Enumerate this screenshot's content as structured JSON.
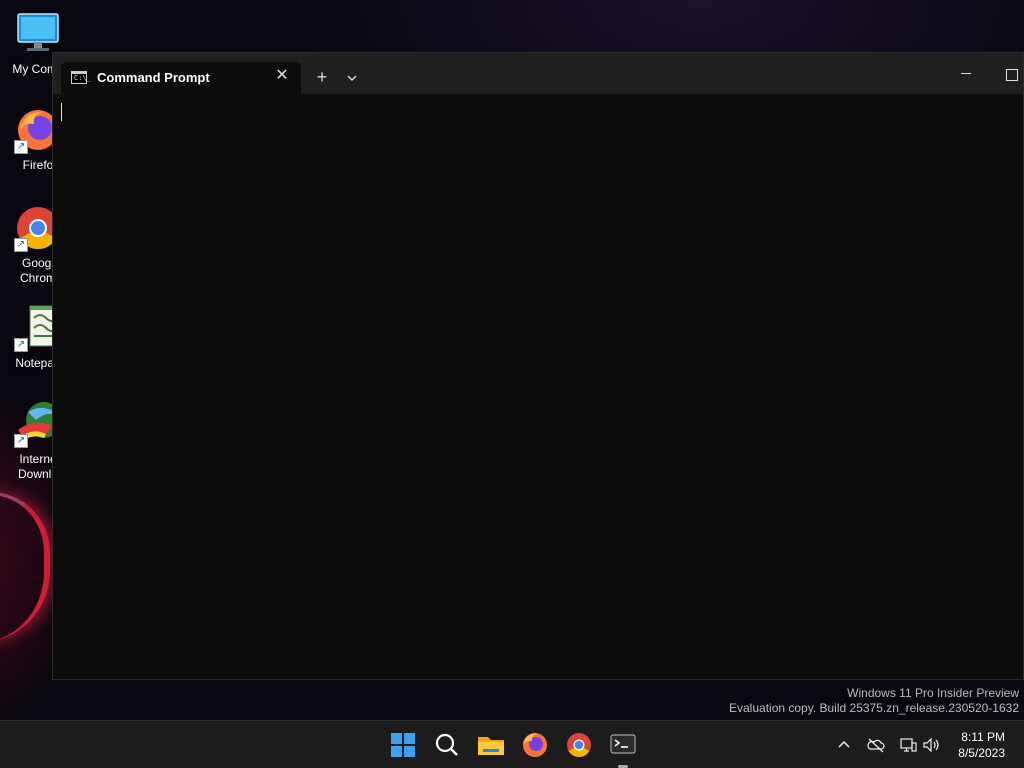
{
  "desktop": {
    "icons": [
      {
        "label": "My Comp",
        "icon": "monitor-icon"
      },
      {
        "label": "Firefo",
        "icon": "firefox-icon"
      },
      {
        "label": "Googl Chrom",
        "icon": "chrome-icon"
      },
      {
        "label": "Notepad",
        "icon": "notepad-icon"
      },
      {
        "label": "Interne Downlo",
        "icon": "download-manager-icon"
      }
    ]
  },
  "terminal": {
    "tab_title": "Command Prompt",
    "tab_icon_text": "C:\\_",
    "close_glyph": "✕",
    "new_tab_glyph": "+",
    "dropdown_glyph": "⌵"
  },
  "watermark": {
    "line1": "Windows 11 Pro Insider Preview",
    "line2": "Evaluation copy. Build 25375.zn_release.230520-1632"
  },
  "taskbar": {
    "apps": [
      "start-icon",
      "search-icon",
      "file-explorer-icon",
      "firefox-icon",
      "chrome-icon",
      "terminal-icon"
    ],
    "tray": {
      "chevron_glyph": "^",
      "icons": [
        "onedrive-icon",
        "network-icon",
        "volume-icon"
      ]
    },
    "clock": {
      "time": "8:11 PM",
      "date": "8/5/2023"
    }
  }
}
